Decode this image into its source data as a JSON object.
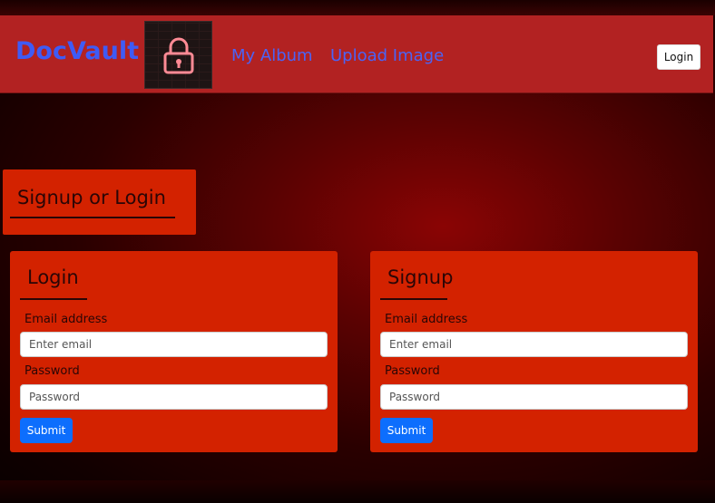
{
  "navbar": {
    "brand": "DocVault",
    "logo_icon": "padlock-icon",
    "links": [
      "My Album",
      "Upload Image"
    ],
    "login_label": "Login",
    "background_color": "#b22222",
    "link_color": "#4b63f5"
  },
  "page_heading": "Signup or Login",
  "login_card": {
    "title": "Login",
    "email_label": "Email address",
    "email_placeholder": "Enter email",
    "password_label": "Password",
    "password_placeholder": "Password",
    "submit_label": "Submit"
  },
  "signup_card": {
    "title": "Signup",
    "email_label": "Email address",
    "email_placeholder": "Enter email",
    "password_label": "Password",
    "password_placeholder": "Password",
    "submit_label": "Submit"
  },
  "colors": {
    "card_background": "#d32200",
    "submit_button": "#0d6efd"
  }
}
